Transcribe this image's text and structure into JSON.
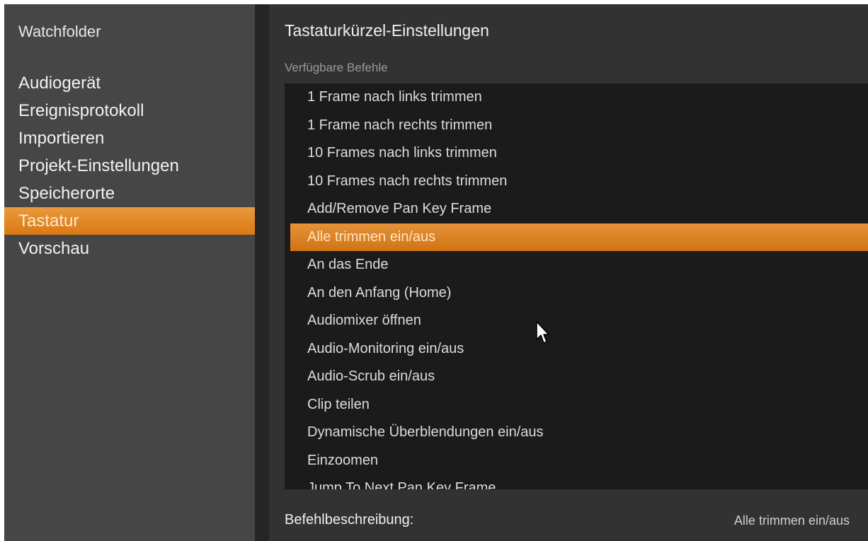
{
  "sidebar": {
    "header": "Watchfolder",
    "items": [
      {
        "label": "Audiogerät"
      },
      {
        "label": "Ereignisprotokoll"
      },
      {
        "label": "Importieren"
      },
      {
        "label": "Projekt-Einstellungen"
      },
      {
        "label": "Speicherorte"
      },
      {
        "label": "Tastatur"
      },
      {
        "label": "Vorschau"
      }
    ],
    "selected": "Tastatur"
  },
  "main": {
    "title": "Tastaturkürzel-Einstellungen",
    "available_label": "Verfügbare Befehle",
    "commands": [
      {
        "label": "1 Frame nach links trimmen"
      },
      {
        "label": "1 Frame nach rechts trimmen"
      },
      {
        "label": "10 Frames nach links trimmen"
      },
      {
        "label": "10 Frames nach rechts trimmen"
      },
      {
        "label": "Add/Remove Pan Key Frame"
      },
      {
        "label": "Alle trimmen ein/aus"
      },
      {
        "label": "An das Ende"
      },
      {
        "label": "An den Anfang (Home)"
      },
      {
        "label": "Audiomixer öffnen"
      },
      {
        "label": "Audio-Monitoring ein/aus"
      },
      {
        "label": "Audio-Scrub ein/aus"
      },
      {
        "label": "Clip teilen"
      },
      {
        "label": "Dynamische Überblendungen ein/aus"
      },
      {
        "label": "Einzoomen"
      },
      {
        "label": "Jump To Next Pan Key Frame"
      }
    ],
    "selected_command": "Alle trimmen ein/aus",
    "description_label": "Befehlbeschreibung:",
    "description_value": "Alle trimmen ein/aus"
  },
  "colors": {
    "accent": "#e08a2a",
    "sidebar_bg": "#464646",
    "list_bg": "#1b1b1b"
  },
  "icons": {
    "cursor": "mouse-pointer-icon"
  }
}
